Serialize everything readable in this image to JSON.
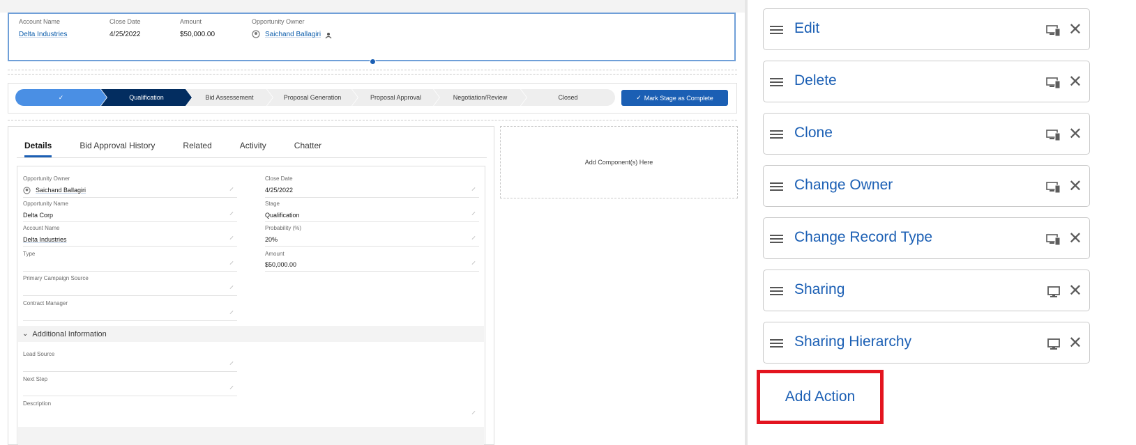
{
  "highlights": {
    "account_name_label": "Account Name",
    "account_name_value": "Delta Industries",
    "close_date_label": "Close Date",
    "close_date_value": "4/25/2022",
    "amount_label": "Amount",
    "amount_value": "$50,000.00",
    "owner_label": "Opportunity Owner",
    "owner_value": "Saichand Ballagiri"
  },
  "path": {
    "stages": [
      "✓",
      "Qualification",
      "Bid Assessement",
      "Proposal Generation",
      "Proposal Approval",
      "Negotiation/Review",
      "Closed"
    ],
    "mark_complete_label": "Mark Stage as Complete"
  },
  "tabs": [
    "Details",
    "Bid Approval History",
    "Related",
    "Activity",
    "Chatter"
  ],
  "details": {
    "opp_owner_label": "Opportunity Owner",
    "opp_owner_value": "Saichand Ballagiri",
    "opp_name_label": "Opportunity Name",
    "opp_name_value": "Delta Corp",
    "account_name_label": "Account Name",
    "account_name_value": "Delta Industries",
    "type_label": "Type",
    "primary_campaign_label": "Primary Campaign Source",
    "contract_manager_label": "Contract Manager",
    "close_date_label": "Close Date",
    "close_date_value": "4/25/2022",
    "stage_label": "Stage",
    "stage_value": "Qualification",
    "probability_label": "Probability (%)",
    "probability_value": "20%",
    "amount_label": "Amount",
    "amount_value": "$50,000.00",
    "additional_info_label": "Additional Information",
    "lead_source_label": "Lead Source",
    "next_step_label": "Next Step",
    "description_label": "Description"
  },
  "add_component_text": "Add Component(s) Here",
  "actions": [
    {
      "label": "Edit",
      "icon": "desktop-mobile-icon"
    },
    {
      "label": "Delete",
      "icon": "desktop-mobile-icon"
    },
    {
      "label": "Clone",
      "icon": "desktop-mobile-icon"
    },
    {
      "label": "Change Owner",
      "icon": "desktop-mobile-icon"
    },
    {
      "label": "Change Record Type",
      "icon": "desktop-mobile-icon"
    },
    {
      "label": "Sharing",
      "icon": "desktop-icon"
    },
    {
      "label": "Sharing Hierarchy",
      "icon": "desktop-icon"
    }
  ],
  "add_action_label": "Add Action",
  "colors": {
    "brand_blue": "#1b5fb4",
    "path_current": "#032d60",
    "path_done": "#4a8fe4",
    "highlight_border": "#e3141f"
  }
}
